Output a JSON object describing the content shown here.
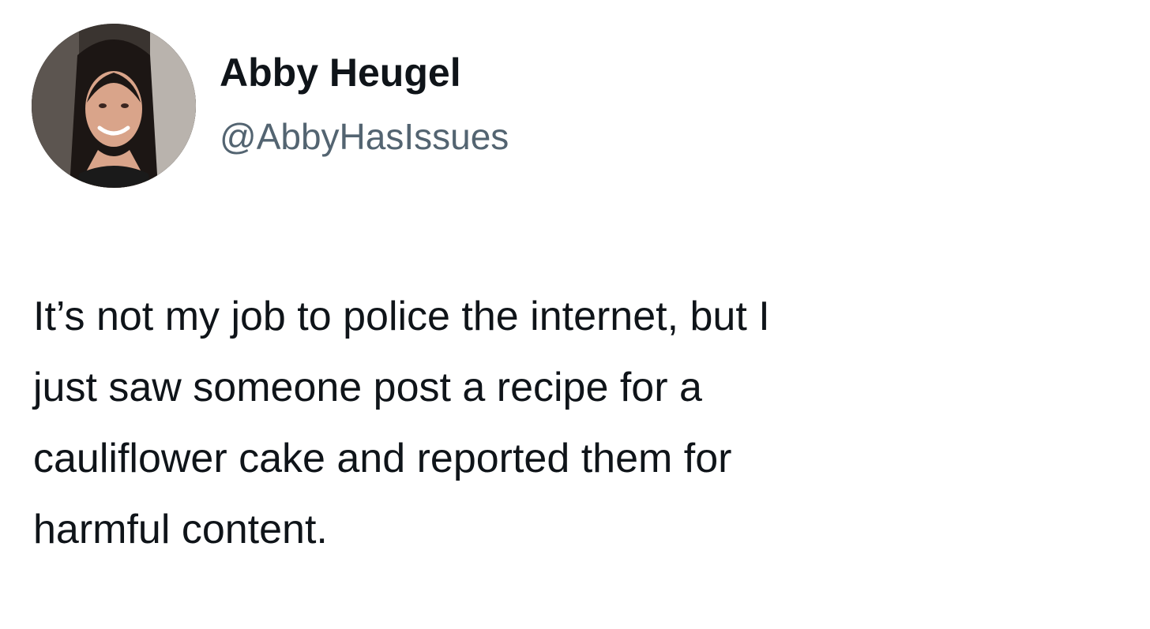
{
  "tweet": {
    "author": {
      "display_name": "Abby Heugel",
      "handle": "@AbbyHasIssues",
      "avatar_icon": "profile-photo"
    },
    "text_lines": [
      "It’s not my job to police the internet, but I",
      "just saw someone post a recipe for a",
      "cauliflower cake and reported them for",
      "harmful content."
    ]
  },
  "colors": {
    "background": "#ffffff",
    "text_primary": "#0f1419",
    "text_secondary": "#536471"
  }
}
